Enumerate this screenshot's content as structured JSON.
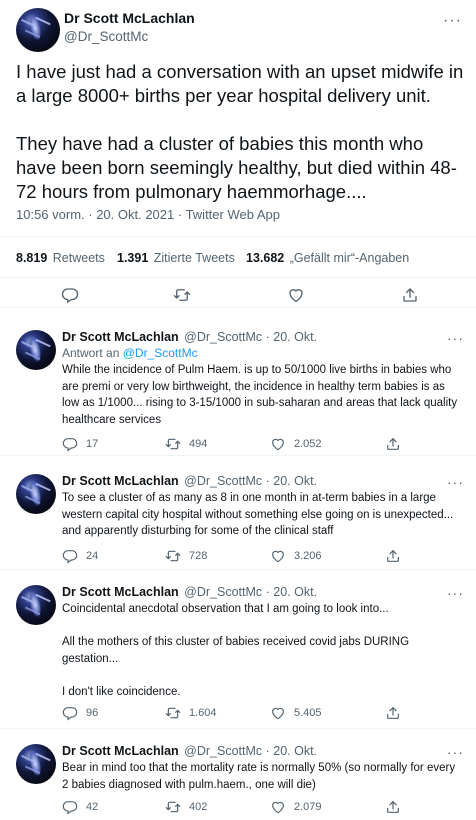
{
  "main_tweet": {
    "name": "Dr Scott McLachlan",
    "handle": "@Dr_ScottMc",
    "text": "I have just had a conversation with an upset midwife in a large 8000+ births per year hospital delivery unit.\n\nThey have had a cluster of babies this month who have been born seemingly healthy, but died within 48-72 hours from pulmonary haemmorhage....",
    "meta": "10:56 vorm. · 20. Okt. 2021 · Twitter Web App",
    "stats": [
      {
        "count": "8.819",
        "label": "Retweets"
      },
      {
        "count": "1.391",
        "label": "Zitierte Tweets"
      },
      {
        "count": "13.682",
        "label": "„Gefällt mir“-Angaben"
      }
    ]
  },
  "replies": [
    {
      "name": "Dr Scott McLachlan",
      "handle": "@Dr_ScottMc · 20. Okt.",
      "reply_to_prefix": "Antwort an",
      "reply_to": "@Dr_ScottMc",
      "text": "While the incidence of Pulm Haem. is up to 50/1000 live births in babies who are premi or very low birthweight, the incidence in healthy term babies is as low as 1/1000... rising to 3-15/1000 in sub-saharan and areas that lack quality healthcare services",
      "replies": "17",
      "retweets": "494",
      "likes": "2.052"
    },
    {
      "name": "Dr Scott McLachlan",
      "handle": "@Dr_ScottMc · 20. Okt.",
      "text": "To see a cluster of as many as 8 in one month in at-term babies in a large western capital city hospital without something else going on is unexpected... and apparently disturbing for some of the clinical staff",
      "replies": "24",
      "retweets": "728",
      "likes": "3.206"
    },
    {
      "name": "Dr Scott McLachlan",
      "handle": "@Dr_ScottMc · 20. Okt.",
      "text": "Coincidental anecdotal observation that I am going to look into...\n\nAll the mothers of this cluster of babies received covid jabs DURING gestation...\n\nI don't like coincidence.",
      "replies": "96",
      "retweets": "1.604",
      "likes": "5.405"
    },
    {
      "name": "Dr Scott McLachlan",
      "handle": "@Dr_ScottMc · 20. Okt.",
      "text": "Bear in mind too that the mortality rate is normally 50% (so normally for every 2 babies diagnosed with pulm.haem., one will die)",
      "replies": "42",
      "retweets": "402",
      "likes": "2.079"
    }
  ],
  "icons": {
    "more": "more-icon",
    "reply": "reply-icon",
    "retweet": "retweet-icon",
    "like": "like-icon",
    "share": "share-icon"
  }
}
